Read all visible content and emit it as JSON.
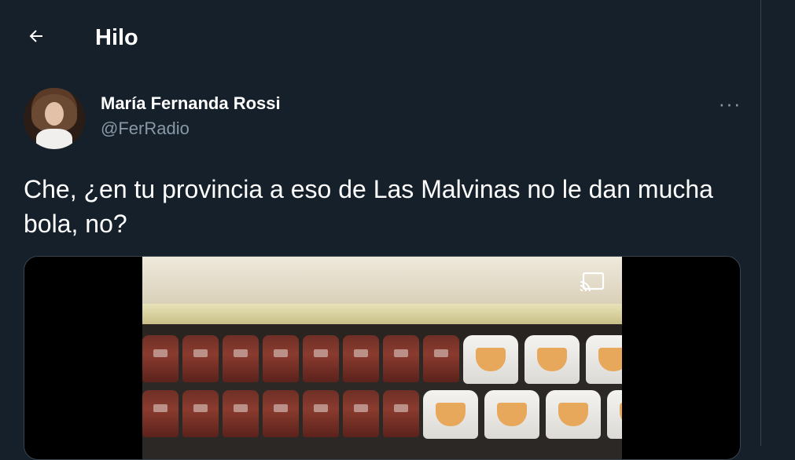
{
  "header": {
    "title": "Hilo",
    "back_icon": "arrow-left-icon"
  },
  "tweet": {
    "author_name": "María Fernanda Rossi",
    "author_handle": "@FerRadio",
    "more_label": "···",
    "text": "Che, ¿en tu provincia a eso de Las Malvinas no le dan mucha bola, no?",
    "media": {
      "type": "video",
      "cast_icon": "cast-icon"
    }
  },
  "colors": {
    "background": "#15202b",
    "text_primary": "#ffffff",
    "text_secondary": "#8899a6",
    "border": "#38444d"
  }
}
